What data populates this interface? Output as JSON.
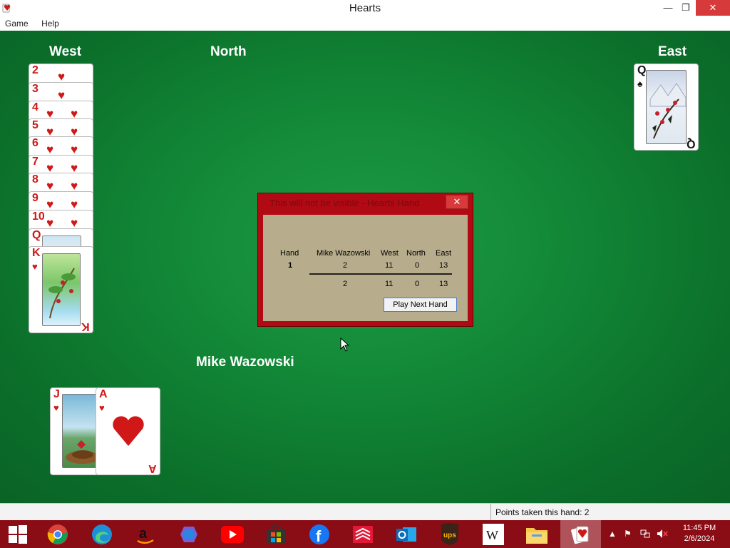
{
  "window": {
    "title": "Hearts",
    "minimize": "—",
    "restore": "❐",
    "close": "✕"
  },
  "menu": [
    "Game",
    "Help"
  ],
  "players": {
    "west": "West",
    "north": "North",
    "east": "East",
    "south": "Mike Wazowski"
  },
  "west_hand": [
    "2",
    "3",
    "4",
    "5",
    "6",
    "7",
    "8",
    "9",
    "10",
    "Q",
    "K"
  ],
  "east_card": {
    "rank": "Q",
    "suit": "♠"
  },
  "south_hand": [
    {
      "rank": "J",
      "suit": "♥"
    },
    {
      "rank": "A",
      "suit": "♥"
    }
  ],
  "dialog": {
    "title": "This will not be visible - Hearts Hand",
    "close": "✕",
    "headers": [
      "Hand",
      "Mike Wazowski",
      "West",
      "North",
      "East"
    ],
    "rows": [
      {
        "hand": "1",
        "mike": "2",
        "west": "11",
        "north": "0",
        "east": "13"
      }
    ],
    "totals": {
      "mike": "2",
      "west": "11",
      "north": "0",
      "east": "13"
    },
    "button": "Play Next Hand"
  },
  "status": "Points taken this hand: 2",
  "taskbar": {
    "clock_time": "11:45 PM",
    "clock_date": "2/6/2024",
    "icons": [
      "windows-start",
      "chrome",
      "edge",
      "amazon",
      "copilot",
      "youtube",
      "microsoft-store",
      "facebook",
      "bank-of-america",
      "outlook",
      "ups",
      "wikipedia",
      "file-explorer",
      "hearts"
    ]
  },
  "colors": {
    "felt": "#138a38",
    "dialog_frame": "#b10a14",
    "dialog_body": "#b7ad8d",
    "taskbar": "#8a0c14",
    "heart_red": "#d01818"
  }
}
